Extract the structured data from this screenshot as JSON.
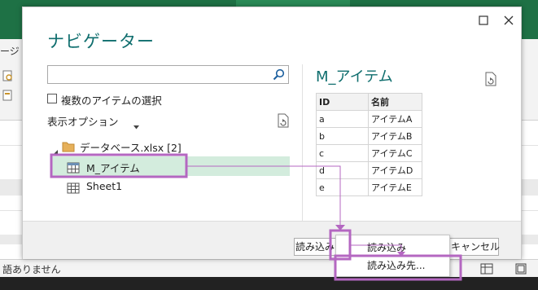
{
  "excel": {
    "side_text_1": "ージ",
    "status_text": "語ありません"
  },
  "dialog": {
    "title": "ナビゲーター",
    "search": {
      "value": "",
      "placeholder": ""
    },
    "multi_select_label": "複数のアイテムの選択",
    "display_options_label": "表示オプション",
    "tree": {
      "folder_label": "データベース.xlsx [2]",
      "items": [
        {
          "label": "M_アイテム",
          "selected": true
        },
        {
          "label": "Sheet1",
          "selected": false
        }
      ]
    },
    "preview": {
      "title": "M_アイテム",
      "columns": [
        "ID",
        "名前"
      ],
      "rows": [
        [
          "a",
          "アイテムA"
        ],
        [
          "b",
          "アイテムB"
        ],
        [
          "c",
          "アイテムC"
        ],
        [
          "d",
          "アイテムD"
        ],
        [
          "e",
          "アイテムE"
        ]
      ]
    },
    "buttons": {
      "load": "読み込み",
      "cancel": "キャンセル"
    },
    "dropdown": {
      "items": [
        "読み込み",
        "読み込み先..."
      ]
    }
  },
  "colors": {
    "title": "#0f6e6e",
    "selection": "#d3ecdd",
    "annotation": "#b467c1",
    "excel_green": "#1e7145"
  }
}
